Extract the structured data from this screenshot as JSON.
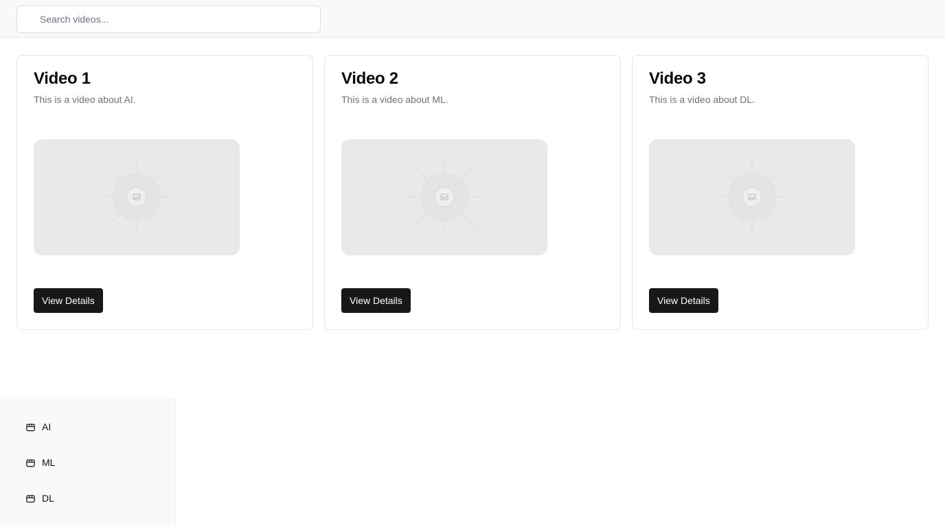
{
  "search": {
    "placeholder": "Search videos..."
  },
  "videos": [
    {
      "title": "Video 1",
      "description": "This is a video about AI.",
      "button_label": "View Details",
      "thumbnail_icon": "image-icon"
    },
    {
      "title": "Video 2",
      "description": "This is a video about ML.",
      "button_label": "View Details",
      "thumbnail_icon": "image-icon"
    },
    {
      "title": "Video 3",
      "description": "This is a video about DL.",
      "button_label": "View Details",
      "thumbnail_icon": "image-icon"
    }
  ],
  "sidebar": {
    "items": [
      {
        "label": "AI",
        "icon": "folder-icon"
      },
      {
        "label": "ML",
        "icon": "folder-icon"
      },
      {
        "label": "DL",
        "icon": "folder-icon"
      }
    ]
  }
}
